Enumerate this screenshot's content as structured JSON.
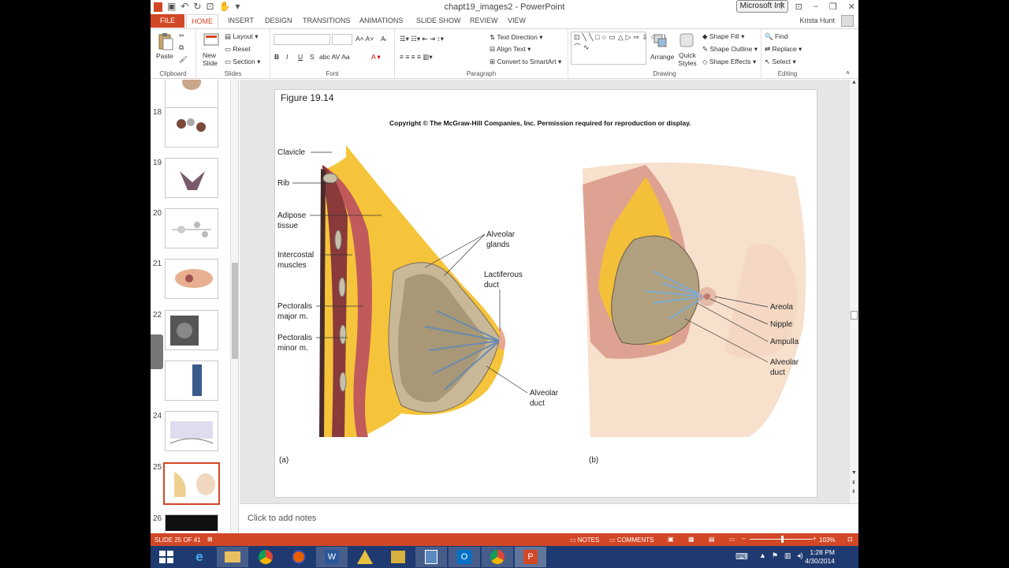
{
  "window": {
    "title": "chapt19_images2 - PowerPoint",
    "ink_button": "Microsoft Ink"
  },
  "tabs": [
    "FILE",
    "HOME",
    "INSERT",
    "DESIGN",
    "TRANSITIONS",
    "ANIMATIONS",
    "SLIDE SHOW",
    "REVIEW",
    "VIEW"
  ],
  "user": "Krista Hunt",
  "ribbon": {
    "clipboard": {
      "paste": "Paste",
      "label": "Clipboard"
    },
    "slides": {
      "new_slide": "New Slide",
      "layout": "Layout",
      "reset": "Reset",
      "section": "Section",
      "label": "Slides"
    },
    "font": {
      "bold": "B",
      "italic": "I",
      "underline": "U",
      "shadow": "S",
      "label": "Font"
    },
    "paragraph": {
      "text_direction": "Text Direction",
      "align_text": "Align Text",
      "convert": "Convert to SmartArt",
      "label": "Paragraph"
    },
    "drawing": {
      "arrange": "Arrange",
      "quick_styles": "Quick Styles",
      "shape_fill": "Shape Fill",
      "shape_outline": "Shape Outline",
      "shape_effects": "Shape Effects",
      "label": "Drawing"
    },
    "editing": {
      "find": "Find",
      "replace": "Replace",
      "select": "Select",
      "label": "Editing"
    }
  },
  "thumbnails": [
    {
      "num": "18"
    },
    {
      "num": "19"
    },
    {
      "num": "20"
    },
    {
      "num": "21"
    },
    {
      "num": "22"
    },
    {
      "num": "23"
    },
    {
      "num": "24"
    },
    {
      "num": "25"
    },
    {
      "num": "26"
    }
  ],
  "slide": {
    "figure_title": "Figure 19.14",
    "copyright": "Copyright © The McGraw-Hill Companies, Inc. Permission required for reproduction or display.",
    "labels_a": {
      "clavicle": "Clavicle",
      "rib": "Rib",
      "adipose1": "Adipose",
      "adipose2": "tissue",
      "intercostal1": "Intercostal",
      "intercostal2": "muscles",
      "pecmaj1": "Pectoralis",
      "pecmaj2": "major m.",
      "pecmin1": "Pectoralis",
      "pecmin2": "minor m.",
      "alv_glands1": "Alveolar",
      "alv_glands2": "glands",
      "lact1": "Lactiferous",
      "lact2": "duct",
      "alv_duct1": "Alveolar",
      "alv_duct2": "duct",
      "panel": "(a)"
    },
    "labels_b": {
      "areola": "Areola",
      "nipple": "Nipple",
      "ampulla": "Ampulla",
      "alv_duct1": "Alveolar",
      "alv_duct2": "duct",
      "panel": "(b)"
    }
  },
  "notes_placeholder": "Click to add notes",
  "status": {
    "slide_info": "SLIDE 25 OF 41",
    "notes": "NOTES",
    "comments": "COMMENTS",
    "zoom": "103%"
  },
  "clock": {
    "time": "1:28 PM",
    "date": "4/30/2014"
  },
  "colors": {
    "accent": "#d24726",
    "taskbar": "#1f3a70"
  }
}
